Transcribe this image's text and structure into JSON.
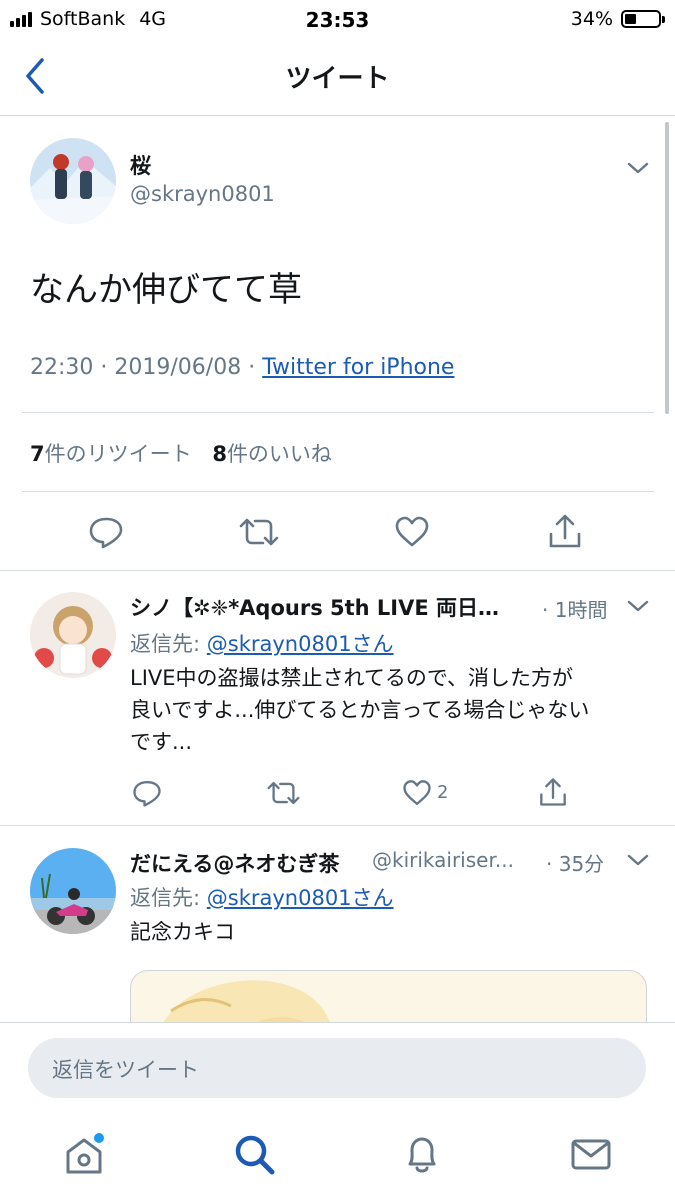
{
  "status_bar": {
    "carrier": "SoftBank",
    "network": "4G",
    "time": "23:53",
    "battery": "34%"
  },
  "nav": {
    "title": "ツイート",
    "back_icon": "chevron-left-icon"
  },
  "tweet": {
    "name": "桜",
    "handle": "@skrayn0801",
    "text": "なんか伸びてて草",
    "time": "22:30",
    "date": "2019/06/08",
    "separator": "·",
    "source": "Twitter for iPhone",
    "retweets_count": "7",
    "retweets_label": "件のリツイート",
    "likes_count": "8",
    "likes_label": "件のいいね"
  },
  "replies": [
    {
      "name": "シノ【✲❈*Aqours 5th LIVE 両日…",
      "time": "· 1時間",
      "reply_label": "返信先:",
      "reply_target": "@skrayn0801さん",
      "text_lines": [
        "LIVE中の盗撮は禁止されてるので、消した方が",
        "良いですよ...伸びてるとか言ってる場合じゃない",
        "です..."
      ],
      "like_count": "2"
    },
    {
      "name": "だにえる@ネオむぎ茶",
      "handle": "@kirikairiser...",
      "time": "· 35分",
      "reply_label": "返信先:",
      "reply_target": "@skrayn0801さん",
      "text": "記念カキコ"
    }
  ],
  "compose": {
    "placeholder": "返信をツイート"
  },
  "tabs": [
    "home-icon",
    "search-icon",
    "bell-icon",
    "mail-icon"
  ],
  "colors": {
    "accent": "#1b5bb5",
    "secondary_text": "#657786",
    "divider": "#d8dde1"
  }
}
